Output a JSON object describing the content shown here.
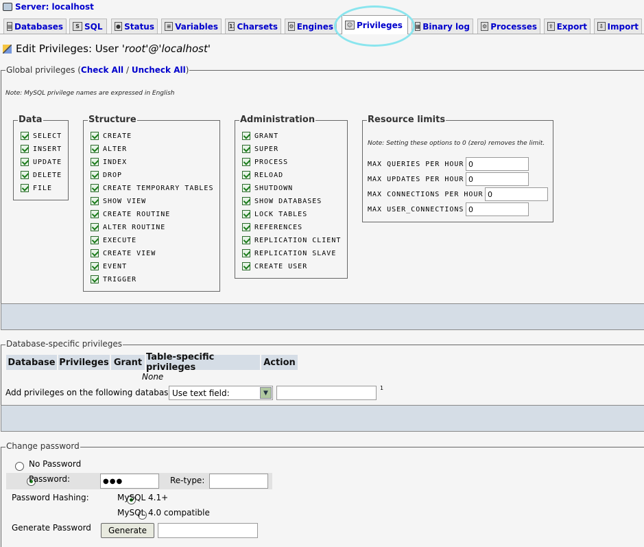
{
  "server": {
    "label": "Server: localhost"
  },
  "tabs": [
    {
      "label": "Databases",
      "icon": "database-icon"
    },
    {
      "label": "SQL",
      "icon": "sql-icon"
    },
    {
      "label": "Status",
      "icon": "status-icon"
    },
    {
      "label": "Variables",
      "icon": "variables-icon"
    },
    {
      "label": "Charsets",
      "icon": "charsets-icon"
    },
    {
      "label": "Engines",
      "icon": "engines-icon"
    },
    {
      "label": "Privileges",
      "icon": "privileges-icon"
    },
    {
      "label": "Binary log",
      "icon": "binary-log-icon"
    },
    {
      "label": "Processes",
      "icon": "processes-icon"
    },
    {
      "label": "Export",
      "icon": "export-icon"
    },
    {
      "label": "Import",
      "icon": "import-icon"
    }
  ],
  "active_tab": "Privileges",
  "page_title": {
    "prefix": "Edit Privileges: User ",
    "user": "'root'@'localhost'"
  },
  "global": {
    "legend": "Global privileges (",
    "check_all": "Check All",
    "separator": " / ",
    "uncheck_all": "Uncheck All",
    "legend_close": ")",
    "note": "Note: MySQL privilege names are expressed in English",
    "groups": {
      "data": {
        "title": "Data",
        "items": [
          "SELECT",
          "INSERT",
          "UPDATE",
          "DELETE",
          "FILE"
        ]
      },
      "structure": {
        "title": "Structure",
        "items": [
          "CREATE",
          "ALTER",
          "INDEX",
          "DROP",
          "CREATE TEMPORARY TABLES",
          "SHOW VIEW",
          "CREATE ROUTINE",
          "ALTER ROUTINE",
          "EXECUTE",
          "CREATE VIEW",
          "EVENT",
          "TRIGGER"
        ]
      },
      "administration": {
        "title": "Administration",
        "items": [
          "GRANT",
          "SUPER",
          "PROCESS",
          "RELOAD",
          "SHUTDOWN",
          "SHOW DATABASES",
          "LOCK TABLES",
          "REFERENCES",
          "REPLICATION CLIENT",
          "REPLICATION SLAVE",
          "CREATE USER"
        ]
      }
    },
    "resource_limits": {
      "title": "Resource limits",
      "note": "Note: Setting these options to 0 (zero) removes the limit.",
      "fields": [
        {
          "label": "MAX QUERIES PER HOUR",
          "value": "0"
        },
        {
          "label": "MAX UPDATES PER HOUR",
          "value": "0"
        },
        {
          "label": "MAX CONNECTIONS PER HOUR",
          "value": "0"
        },
        {
          "label": "MAX USER_CONNECTIONS",
          "value": "0"
        }
      ]
    }
  },
  "db_specific": {
    "legend": "Database-specific privileges",
    "columns": [
      "Database",
      "Privileges",
      "Grant",
      "Table-specific privileges",
      "Action"
    ],
    "none_text": "None",
    "add_label": "Add privileges on the following database:",
    "select_value": "Use text field:",
    "text_value": "",
    "footnote": "1"
  },
  "change_password": {
    "legend": "Change password",
    "no_password": "No Password",
    "password_label": "Password:",
    "password_value": "●●●",
    "retype_label": "Re-type:",
    "retype_value": "",
    "hashing_label": "Password Hashing:",
    "hash_41": "MySQL 4.1+",
    "hash_40": "MySQL 4.0 compatible",
    "generate_label": "Generate Password",
    "generate_button": "Generate",
    "generated_value": ""
  }
}
